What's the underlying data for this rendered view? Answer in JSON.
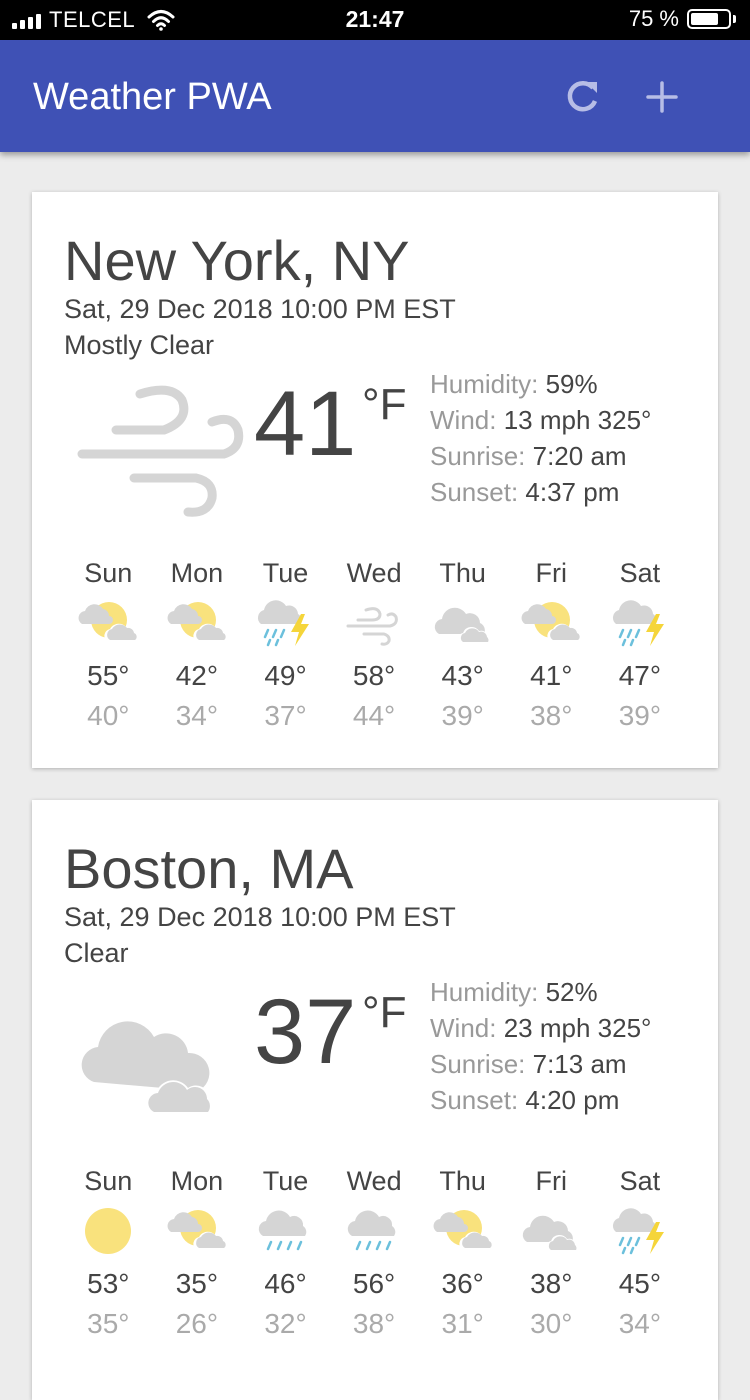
{
  "status_bar": {
    "carrier": "TELCEL",
    "time": "21:47",
    "battery": "75 %",
    "battery_level": 0.75
  },
  "header": {
    "title": "Weather PWA",
    "refresh_icon": "refresh-icon",
    "add_icon": "plus-icon"
  },
  "cards": [
    {
      "city": "New York, NY",
      "date": "Sat, 29 Dec 2018 10:00 PM EST",
      "description": "Mostly Clear",
      "icon": "windy-icon",
      "temperature": "41",
      "unit": "°F",
      "humidity_label": "Humidity:",
      "humidity": "59%",
      "wind_label": "Wind:",
      "wind": "13 mph 325°",
      "sunrise_label": "Sunrise:",
      "sunrise": "7:20 am",
      "sunset_label": "Sunset:",
      "sunset": "4:37 pm",
      "forecast": [
        {
          "day": "Sun",
          "icon": "partly-cloudy-icon",
          "high": "55°",
          "low": "40°"
        },
        {
          "day": "Mon",
          "icon": "partly-cloudy-icon",
          "high": "42°",
          "low": "34°"
        },
        {
          "day": "Tue",
          "icon": "thunderstorm-icon",
          "high": "49°",
          "low": "37°"
        },
        {
          "day": "Wed",
          "icon": "windy-icon",
          "high": "58°",
          "low": "44°"
        },
        {
          "day": "Thu",
          "icon": "cloudy-icon",
          "high": "43°",
          "low": "39°"
        },
        {
          "day": "Fri",
          "icon": "partly-cloudy-icon",
          "high": "41°",
          "low": "38°"
        },
        {
          "day": "Sat",
          "icon": "thunderstorm-icon",
          "high": "47°",
          "low": "39°"
        }
      ]
    },
    {
      "city": "Boston, MA",
      "date": "Sat, 29 Dec 2018 10:00 PM EST",
      "description": "Clear",
      "icon": "cloudy-icon",
      "temperature": "37",
      "unit": "°F",
      "humidity_label": "Humidity:",
      "humidity": "52%",
      "wind_label": "Wind:",
      "wind": "23 mph 325°",
      "sunrise_label": "Sunrise:",
      "sunrise": "7:13 am",
      "sunset_label": "Sunset:",
      "sunset": "4:20 pm",
      "forecast": [
        {
          "day": "Sun",
          "icon": "sunny-icon",
          "high": "53°",
          "low": "35°"
        },
        {
          "day": "Mon",
          "icon": "partly-cloudy-icon",
          "high": "35°",
          "low": "26°"
        },
        {
          "day": "Tue",
          "icon": "rain-icon",
          "high": "46°",
          "low": "32°"
        },
        {
          "day": "Wed",
          "icon": "rain-icon",
          "high": "56°",
          "low": "38°"
        },
        {
          "day": "Thu",
          "icon": "partly-cloudy-icon",
          "high": "36°",
          "low": "31°"
        },
        {
          "day": "Fri",
          "icon": "cloudy-icon",
          "high": "38°",
          "low": "30°"
        },
        {
          "day": "Sat",
          "icon": "thunderstorm-icon",
          "high": "45°",
          "low": "34°"
        }
      ]
    }
  ],
  "colors": {
    "app_bar": "#3f51b5",
    "background": "#ececec",
    "sun": "#f9e27d",
    "cloud": "#d5d5d5",
    "rain": "#6cc0dc",
    "bolt": "#f5d53a"
  }
}
